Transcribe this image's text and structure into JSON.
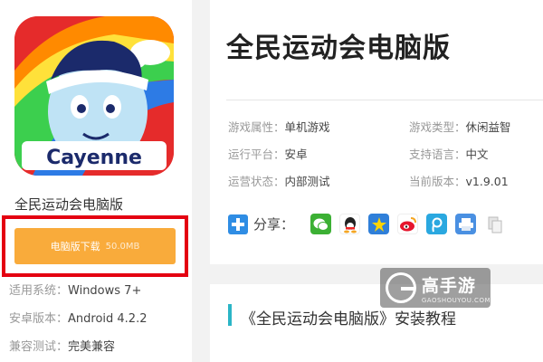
{
  "app": {
    "name": "全民运动会电脑版",
    "icon_text": "Cayenne",
    "download_label": "电脑版下载",
    "download_size": "50.0MB",
    "meta": [
      {
        "key": "适用系统：",
        "value": "Windows 7+"
      },
      {
        "key": "安卓版本：",
        "value": "Android 4.2.2"
      },
      {
        "key": "兼容测试：",
        "value": "完美兼容"
      }
    ]
  },
  "main": {
    "title": "全民运动会电脑版",
    "info": [
      {
        "key": "游戏属性：",
        "value": "单机游戏"
      },
      {
        "key": "游戏类型：",
        "value": "休闲益智"
      },
      {
        "key": "运行平台：",
        "value": "安卓"
      },
      {
        "key": "支持语言：",
        "value": "中文"
      },
      {
        "key": "运营状态：",
        "value": "内部测试"
      },
      {
        "key": "当前版本：",
        "value": "v1.9.01"
      }
    ],
    "share_label": "分享：",
    "share_icons": [
      "wechat-icon",
      "qq-icon",
      "qzone-icon",
      "weibo-icon",
      "tencent-weibo-icon",
      "print-icon",
      "copy-icon"
    ]
  },
  "section": {
    "title": "《全民运动会电脑版》安装教程"
  },
  "watermark": {
    "title": "高手游",
    "subtitle": "GAOSHOUYOU.COM"
  },
  "colors": {
    "download_button": "#f9ab3b",
    "highlight_frame": "#e40011",
    "section_accent": "#2bb5c6",
    "share_plus": "#2f8de4"
  }
}
